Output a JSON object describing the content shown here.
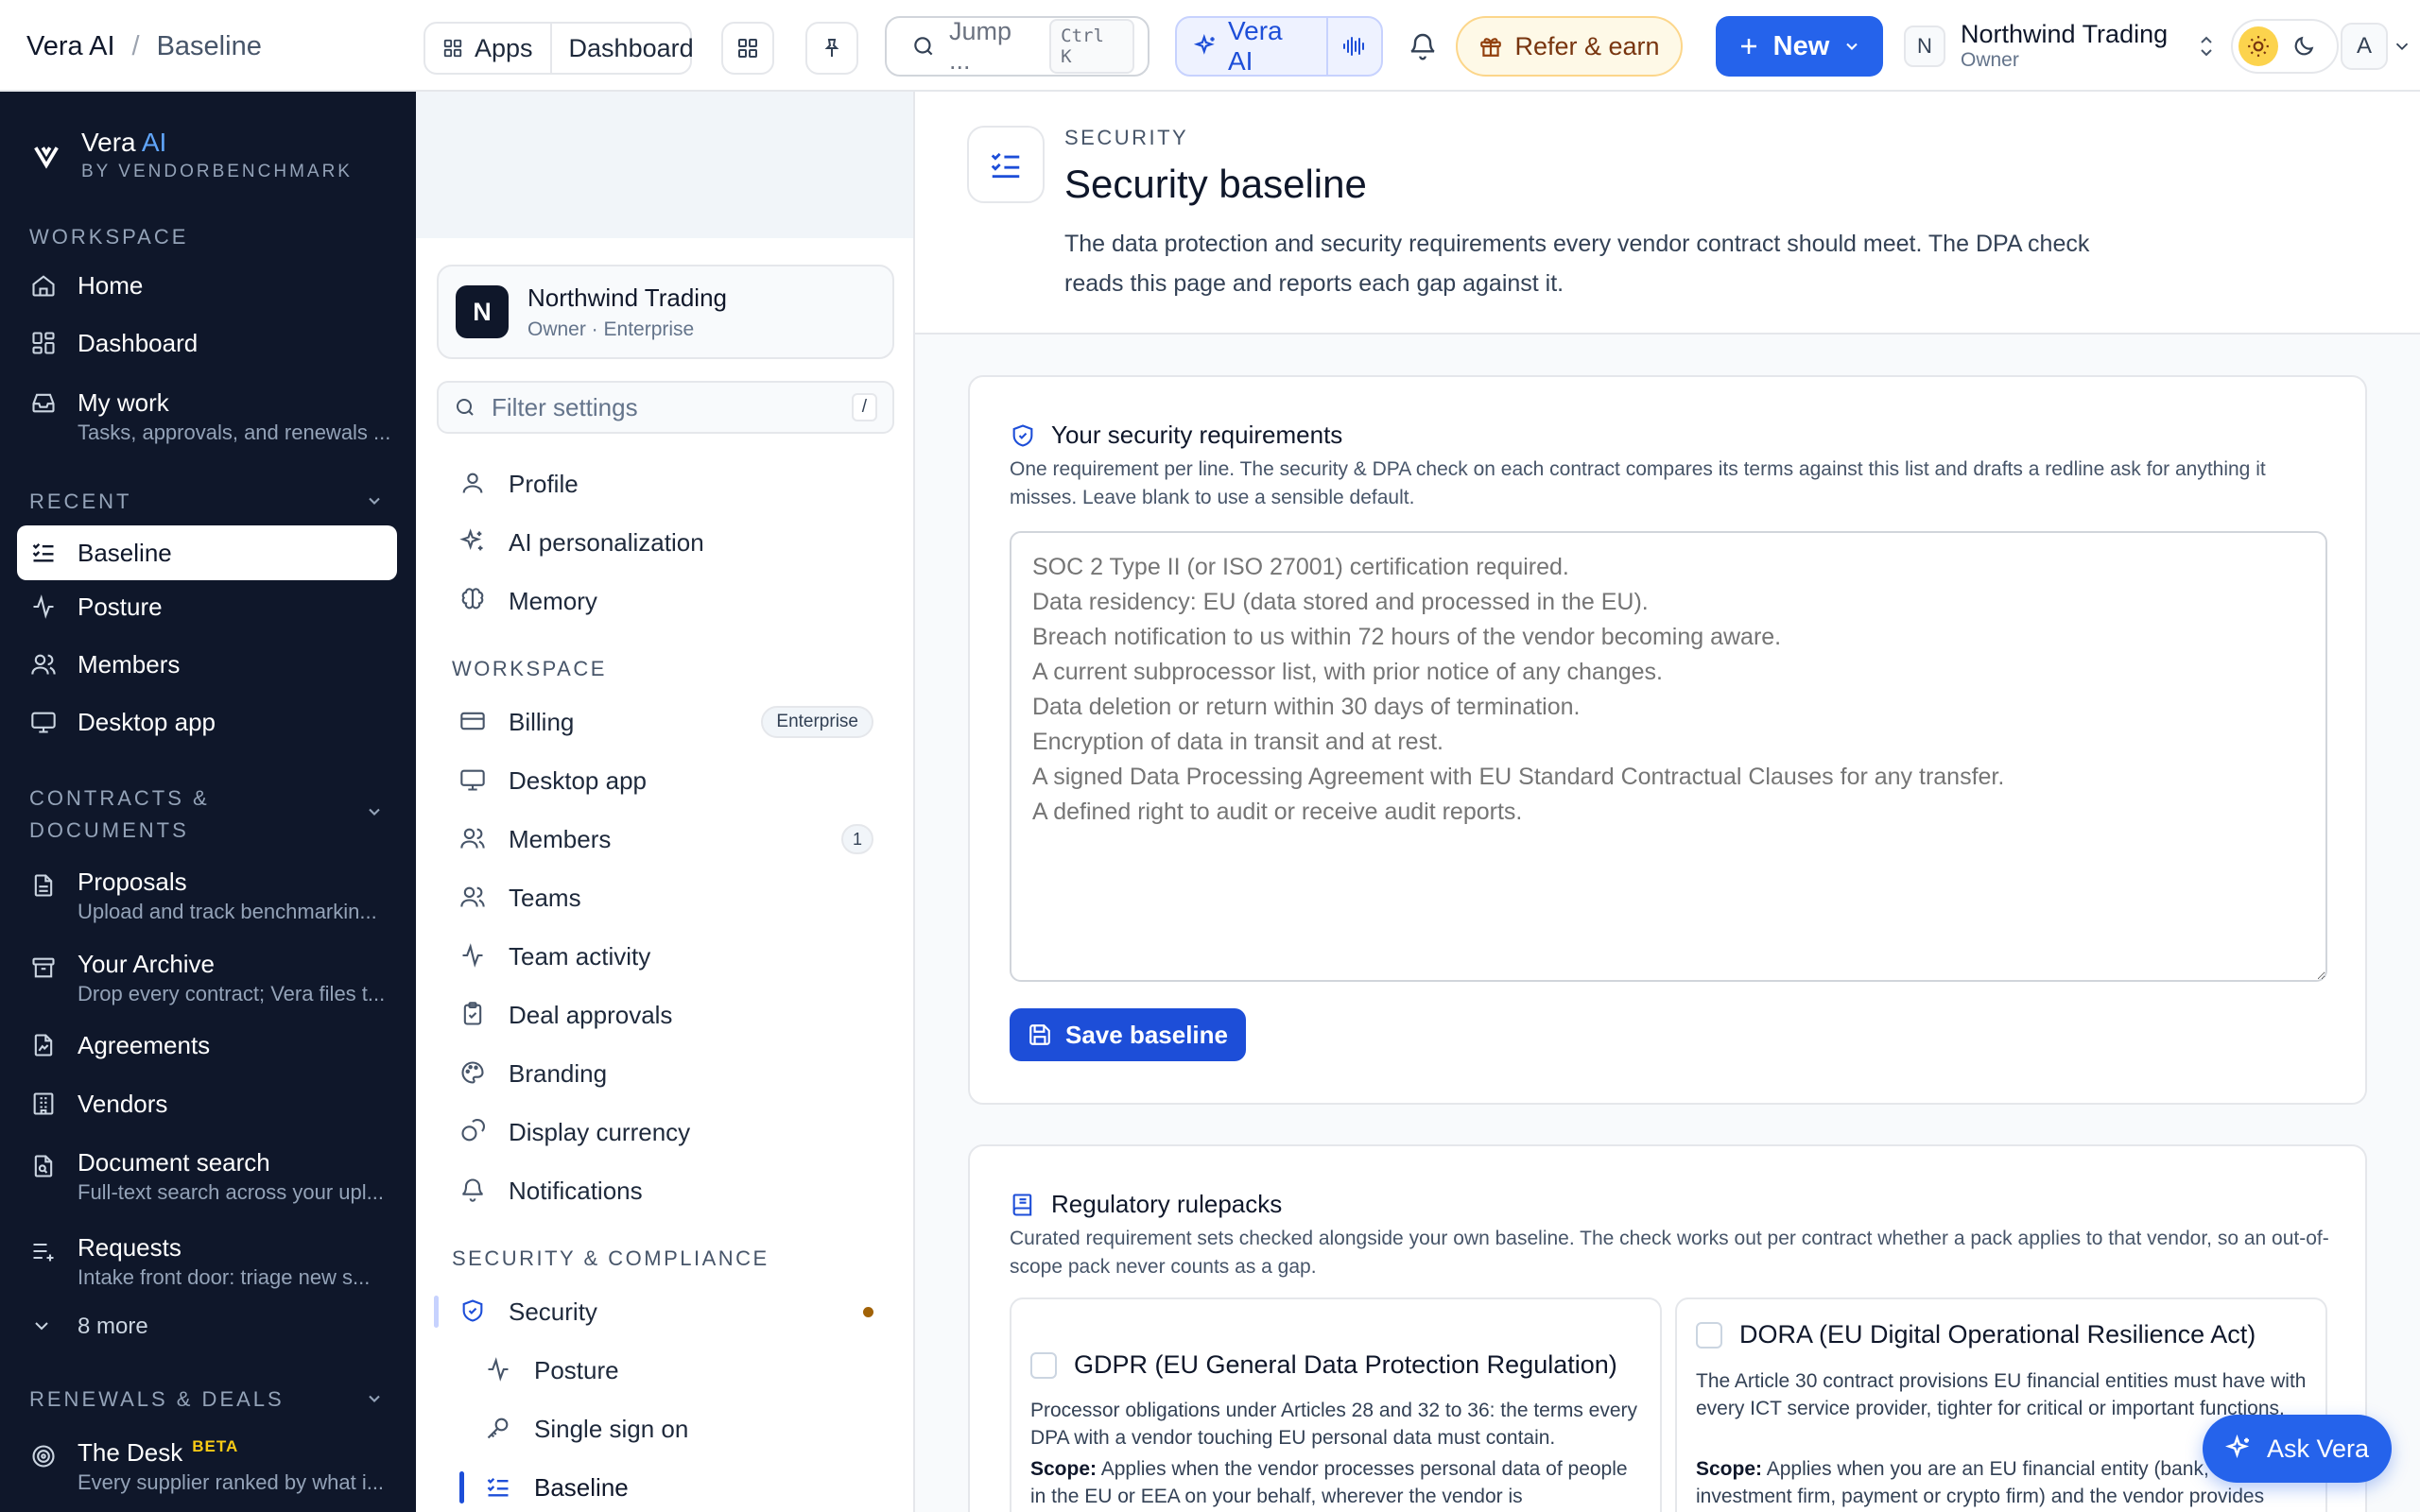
{
  "topbar": {
    "app_name": "Vera AI",
    "breadcrumb_current": "Baseline",
    "apps_label": "Apps",
    "dashboard_label": "Dashboard",
    "jump_placeholder": "Jump ...",
    "jump_shortcut": "Ctrl K",
    "vera_ai_label": "Vera AI",
    "refer_label": "Refer & earn",
    "new_label": "New",
    "org_initial": "N",
    "org_name": "Northwind Trading",
    "org_role": "Owner",
    "user_initial": "A"
  },
  "leftnav": {
    "brand_name": "Vera",
    "brand_accent": "AI",
    "brand_by": "BY VENDORBENCHMARK",
    "sections": {
      "workspace": "WORKSPACE",
      "recent": "RECENT",
      "contracts": "CONTRACTS &",
      "contracts2": "DOCUMENTS",
      "renewals": "RENEWALS & DEALS"
    },
    "items": {
      "home": "Home",
      "dashboard": "Dashboard",
      "my_work": "My work",
      "my_work_sub": "Tasks, approvals, and renewals ...",
      "baseline": "Baseline",
      "posture": "Posture",
      "members": "Members",
      "desktop_app": "Desktop app",
      "proposals": "Proposals",
      "proposals_sub": "Upload and track benchmarkin...",
      "archive": "Your Archive",
      "archive_sub": "Drop every contract; Vera files t...",
      "agreements": "Agreements",
      "vendors": "Vendors",
      "doc_search": "Document search",
      "doc_search_sub": "Full-text search across your upl...",
      "requests": "Requests",
      "requests_sub": "Intake front door: triage new s...",
      "more": "8 more",
      "desk": "The Desk",
      "desk_badge": "BETA",
      "desk_sub": "Every supplier ranked by what i..."
    }
  },
  "settings": {
    "org_initial": "N",
    "org_name": "Northwind Trading",
    "org_sub": "Owner · Enterprise",
    "filter_placeholder": "Filter settings",
    "filter_shortcut": "/",
    "items": {
      "profile": "Profile",
      "ai_personalization": "AI personalization",
      "memory": "Memory",
      "workspace_header": "WORKSPACE",
      "billing": "Billing",
      "billing_badge": "Enterprise",
      "desktop_app": "Desktop app",
      "members": "Members",
      "members_count": "1",
      "teams": "Teams",
      "team_activity": "Team activity",
      "deal_approvals": "Deal approvals",
      "branding": "Branding",
      "display_currency": "Display currency",
      "notifications": "Notifications",
      "security_header": "SECURITY & COMPLIANCE",
      "security": "Security",
      "posture": "Posture",
      "sso": "Single sign on",
      "baseline": "Baseline"
    }
  },
  "main": {
    "overline": "SECURITY",
    "title": "Security baseline",
    "description": "The data protection and security requirements every vendor contract should meet. The DPA check reads this page and reports each gap against it.",
    "requirements": {
      "title": "Your security requirements",
      "subtitle": "One requirement per line. The security & DPA check on each contract compares its terms against this list and drafts a redline ask for anything it misses. Leave blank to use a sensible default.",
      "placeholder": "SOC 2 Type II (or ISO 27001) certification required.\nData residency: EU (data stored and processed in the EU).\nBreach notification to us within 72 hours of the vendor becoming aware.\nA current subprocessor list, with prior notice of any changes.\nData deletion or return within 30 days of termination.\nEncryption of data in transit and at rest.\nA signed Data Processing Agreement with EU Standard Contractual Clauses for any transfer.\nA defined right to audit or receive audit reports.",
      "save_label": "Save baseline"
    },
    "rulepacks": {
      "title": "Regulatory rulepacks",
      "subtitle": "Curated requirement sets checked alongside your own baseline. The check works out per contract whether a pack applies to that vendor, so an out-of-scope pack never counts as a gap.",
      "packs": [
        {
          "name": "GDPR (EU General Data Protection Regulation)",
          "desc": "Processor obligations under Articles 28 and 32 to 36: the terms every DPA with a vendor touching EU personal data must contain.",
          "scope_label": "Scope:",
          "scope": "Applies when the vendor processes personal data of people in the EU or EEA on your behalf, wherever the vendor is"
        },
        {
          "name": "DORA (EU Digital Operational Resilience Act)",
          "desc": "The Article 30 contract provisions EU financial entities must have with every ICT service provider, tighter for critical or important functions.",
          "scope_label": "Scope:",
          "scope": "Applies when you are an EU financial entity (bank, investment firm, payment or crypto firm) and the vendor provides"
        }
      ]
    },
    "ask_label": "Ask Vera"
  }
}
